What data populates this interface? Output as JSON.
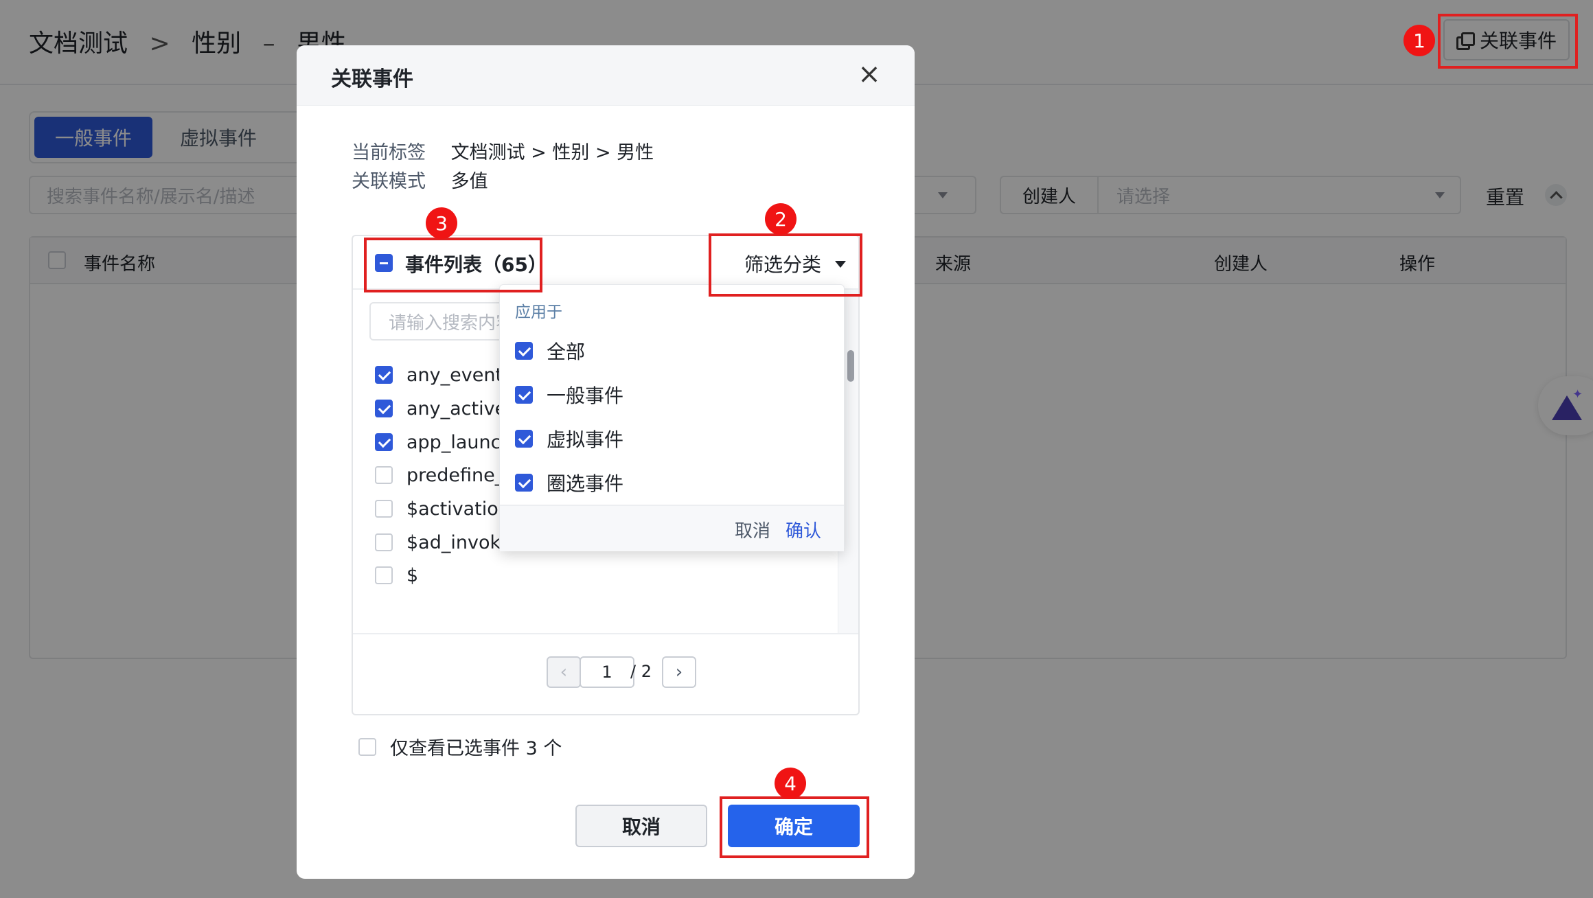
{
  "background": {
    "breadcrumb": [
      "文档测试",
      ">",
      "性别",
      "–",
      "男性"
    ],
    "link_button": "关联事件",
    "tabs": [
      "一般事件",
      "虚拟事件"
    ],
    "search_placeholder": "搜索事件名称/展示名/描述",
    "creator_label": "创建人",
    "creator_placeholder": "请选择",
    "reset_label": "重置",
    "table_headers": {
      "event_name": "事件名称",
      "source": "来源",
      "creator": "创建人",
      "actions": "操作"
    }
  },
  "modal": {
    "title": "关联事件",
    "close_icon": "×",
    "current_tag_label": "当前标签",
    "current_tag_value": "文档测试 > 性别 > 男性",
    "mode_label": "关联模式",
    "mode_value": "多值",
    "list_title": "事件列表（65）",
    "filter_label": "筛选分类",
    "search_placeholder": "请输入搜索内容",
    "events": [
      {
        "name": "any_event",
        "checked": true
      },
      {
        "name": "any_active_",
        "checked": true
      },
      {
        "name": "app_launch",
        "checked": true
      },
      {
        "name": "predefine_p",
        "checked": false
      },
      {
        "name": "$activation",
        "checked": false
      },
      {
        "name": "$ad_invoke",
        "checked": false
      },
      {
        "name": "$",
        "checked": false
      }
    ],
    "pagination": {
      "prev": "‹",
      "current": "1",
      "total": "/ 2",
      "next": "›"
    },
    "only_selected": "仅查看已选事件 3 个",
    "cancel": "取消",
    "confirm": "确定"
  },
  "filter_dropdown": {
    "section_title": "应用于",
    "options": [
      {
        "label": "全部",
        "checked": true
      },
      {
        "label": "一般事件",
        "checked": true
      },
      {
        "label": "虚拟事件",
        "checked": true
      },
      {
        "label": "圈选事件",
        "checked": true
      }
    ],
    "cancel": "取消",
    "confirm": "确认"
  },
  "annotations": [
    "1",
    "2",
    "3",
    "4"
  ],
  "colors": {
    "primary": "#2f59d9",
    "annotation": "#e02020"
  }
}
